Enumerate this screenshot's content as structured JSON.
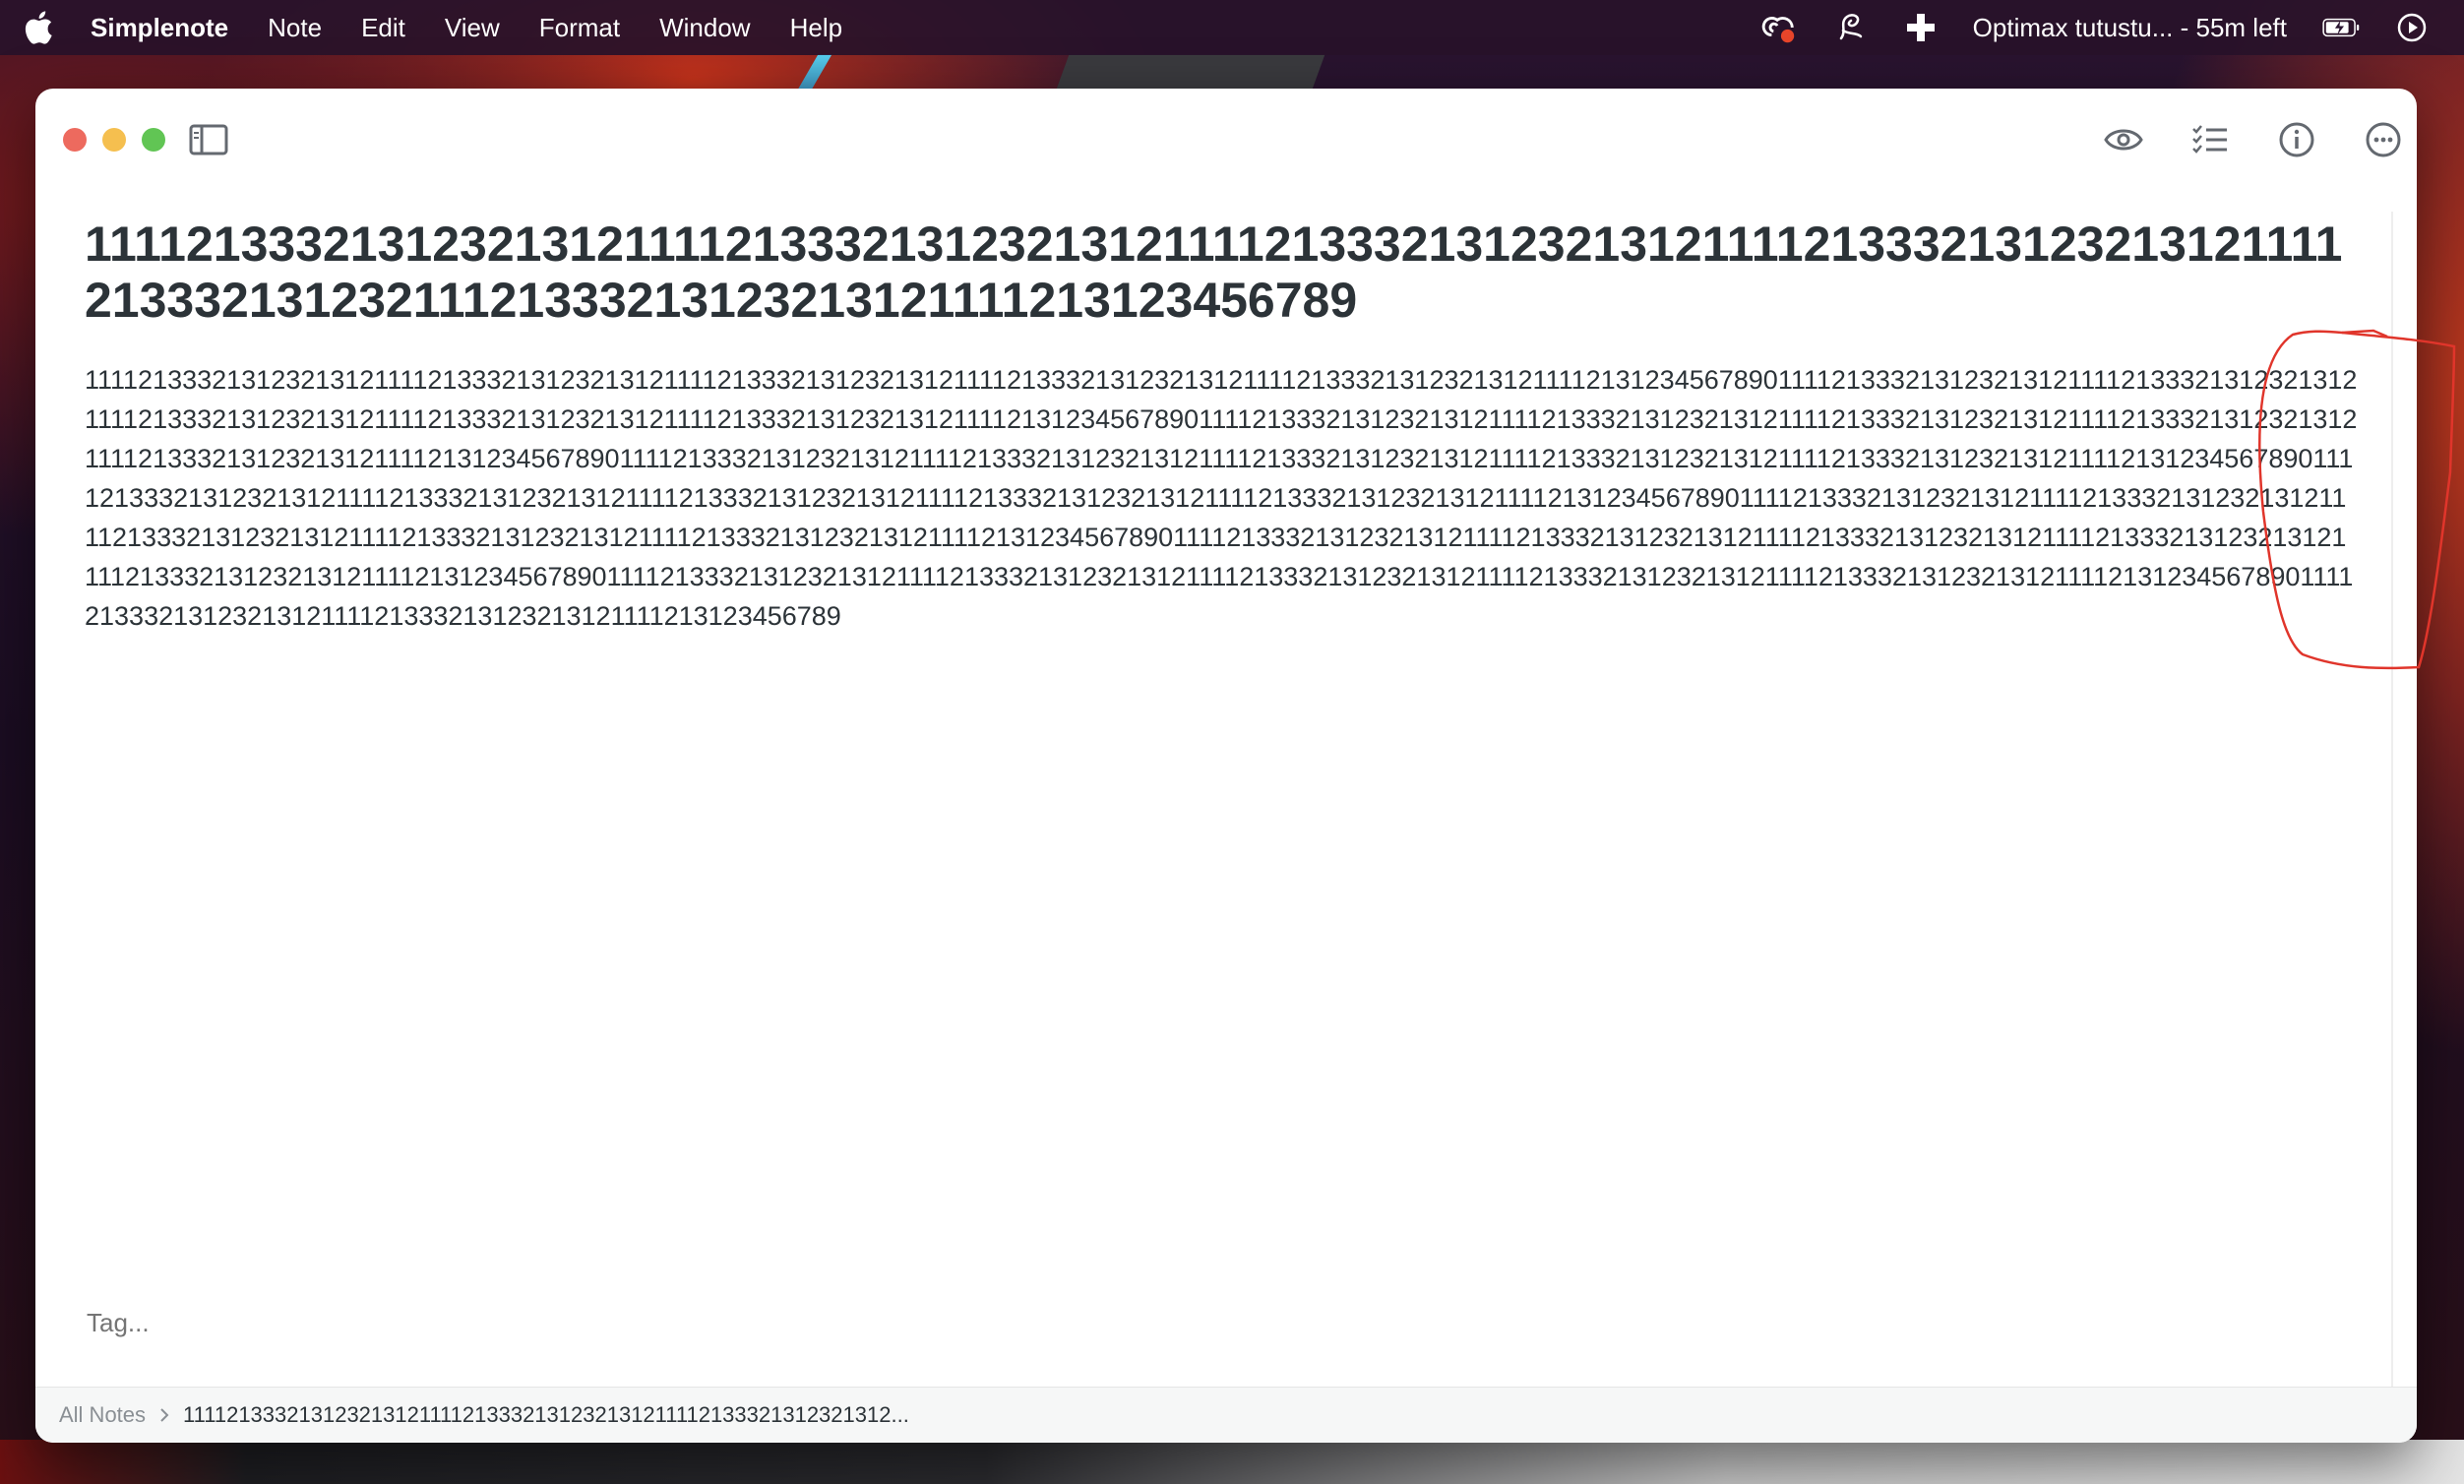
{
  "menubar": {
    "app_name": "Simplenote",
    "menus": [
      "Note",
      "Edit",
      "View",
      "Format",
      "Window",
      "Help"
    ],
    "status_text": "Optimax tutustu... - 55m left",
    "icons": [
      "creative-cloud-icon",
      "script-icon",
      "plus-cross-icon",
      "battery-icon",
      "play-icon"
    ]
  },
  "note": {
    "title": "11112133321312321312111121333213123213121111213332131232131211112133321312321312111121333213123211121333213123213121111213123456789",
    "body": "11112133321312321312111121333213123213121111213332131232131211112133321312321312111121333213123213121111213123456789011112133321312321312111121333213123213121111213332131232131211112133321312321312111121333213123213121111213123456789011112133321312321312111121333213123213121111213332131232131211112133321312321312111121333213123213121111213123456789011112133321312321312111121333213123213121111213332131232131211112133321312321312111121333213123213121111213123456789011112133321312321312111121333213123213121111213332131232131211112133321312321312111121333213123213121111213123456789011112133321312321312111121333213123213121111213332131232131211112133321312321312111121333213123213121111213123456789011112133321312321312111121333213123213121111213332131232131211112133321312321312111121333213123213121111213123456789011112133321312321312111121333213123213121111213332131232131211112133321312321312111121333213123213121111213123456789011112133321312321312111121333213123213121111213123456789"
  },
  "tags": {
    "placeholder": "Tag..."
  },
  "breadcrumb": {
    "root": "All Notes",
    "current": "1111213332131232131211112133321312321312111121333213123213​12..."
  },
  "toolbar": {
    "icons": [
      "eye-icon",
      "checklist-icon",
      "info-icon",
      "more-icon"
    ]
  },
  "colors": {
    "text": "#2c3338",
    "annotation": "#e0352b"
  }
}
